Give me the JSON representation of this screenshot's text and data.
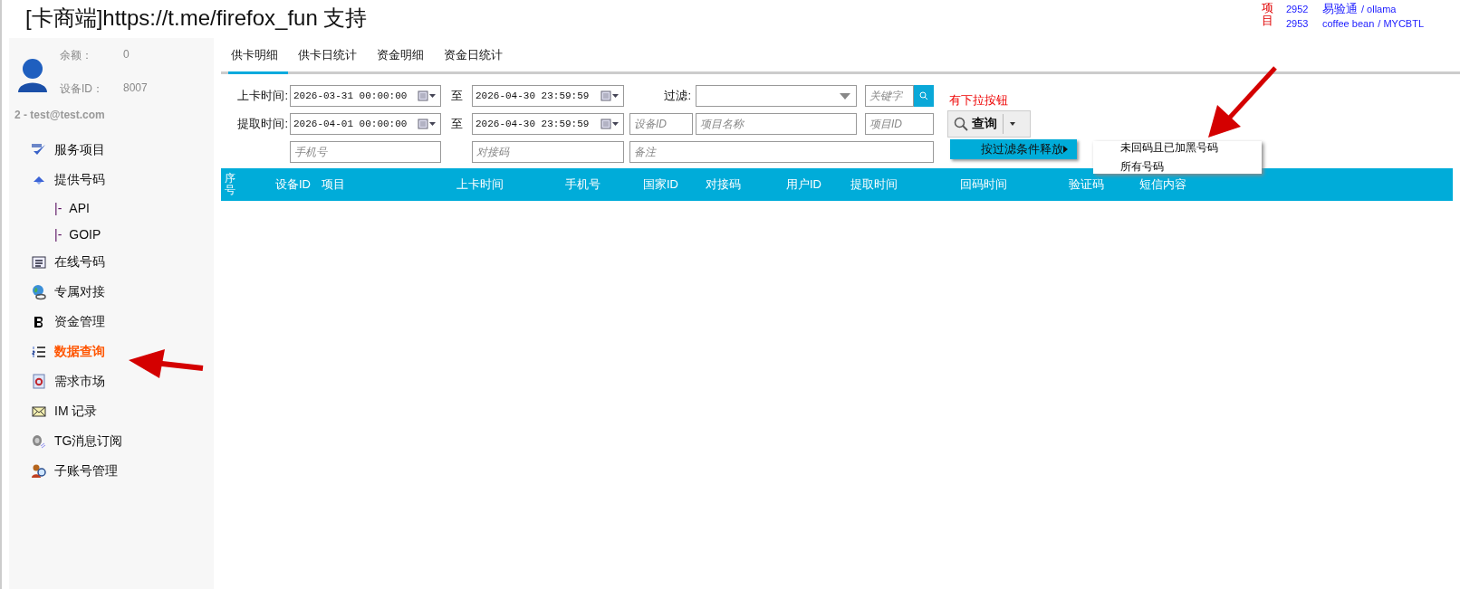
{
  "title": "[卡商端]https://t.me/firefox_fun 支持",
  "news": {
    "label": "项目",
    "items": [
      {
        "id": "2952",
        "name": "易验通",
        "owner": "/ ollama"
      },
      {
        "id": "2953",
        "name": "coffee bean",
        "owner": "/ MYCBTL"
      }
    ]
  },
  "sidebar": {
    "balance_label": "余额：",
    "balance": "0",
    "device_label": "设备ID：",
    "device": "8007",
    "account": "2 - test@test.com",
    "items": [
      {
        "label": "服务项目",
        "selected": false
      },
      {
        "label": "提供号码",
        "selected": false,
        "children": [
          {
            "marker": "|-",
            "label": "API",
            "selected": false
          },
          {
            "marker": "|-",
            "label": "GOIP",
            "selected": false
          }
        ]
      },
      {
        "label": "在线号码",
        "selected": false
      },
      {
        "label": "专属对接",
        "selected": false
      },
      {
        "label": "资金管理",
        "selected": false
      },
      {
        "label": "数据查询",
        "selected": true
      },
      {
        "label": "需求市场",
        "selected": false
      },
      {
        "label": "IM 记录",
        "selected": false
      },
      {
        "label": "TG消息订阅",
        "selected": false
      },
      {
        "label": "子账号管理",
        "selected": false
      }
    ]
  },
  "tabs": [
    {
      "label": "供卡明细",
      "selected": true
    },
    {
      "label": "供卡日统计",
      "selected": false
    },
    {
      "label": "资金明细",
      "selected": false
    },
    {
      "label": "资金日统计",
      "selected": false
    }
  ],
  "filters": {
    "load_label": "上卡时间:",
    "load_from": "2026-03-31 00:00:00",
    "load_to_label": "至",
    "load_to": "2026-04-30 23:59:59",
    "filter_label": "过滤:",
    "keyword_placeholder": "关键字",
    "fetch_label": "提取时间:",
    "fetch_from": "2026-04-01 00:00:00",
    "fetch_to_label": "至",
    "fetch_to": "2026-04-30 23:59:59",
    "device_placeholder": "设备ID",
    "project_name_placeholder": "项目名称",
    "project_id_placeholder": "项目ID",
    "phone_placeholder": "手机号",
    "code_placeholder": "对接码",
    "note_placeholder": "备注"
  },
  "query": {
    "label": "查询",
    "note": "有下拉按钮",
    "menu_item": "按过滤条件释放",
    "submenu": [
      "未回码且已加黑号码",
      "所有号码"
    ]
  },
  "table": {
    "columns": [
      "序号",
      "设备ID",
      "项目",
      "上卡时间",
      "手机号",
      "国家ID",
      "对接码",
      "用户ID",
      "提取时间",
      "回码时间",
      "验证码",
      "短信内容"
    ]
  }
}
